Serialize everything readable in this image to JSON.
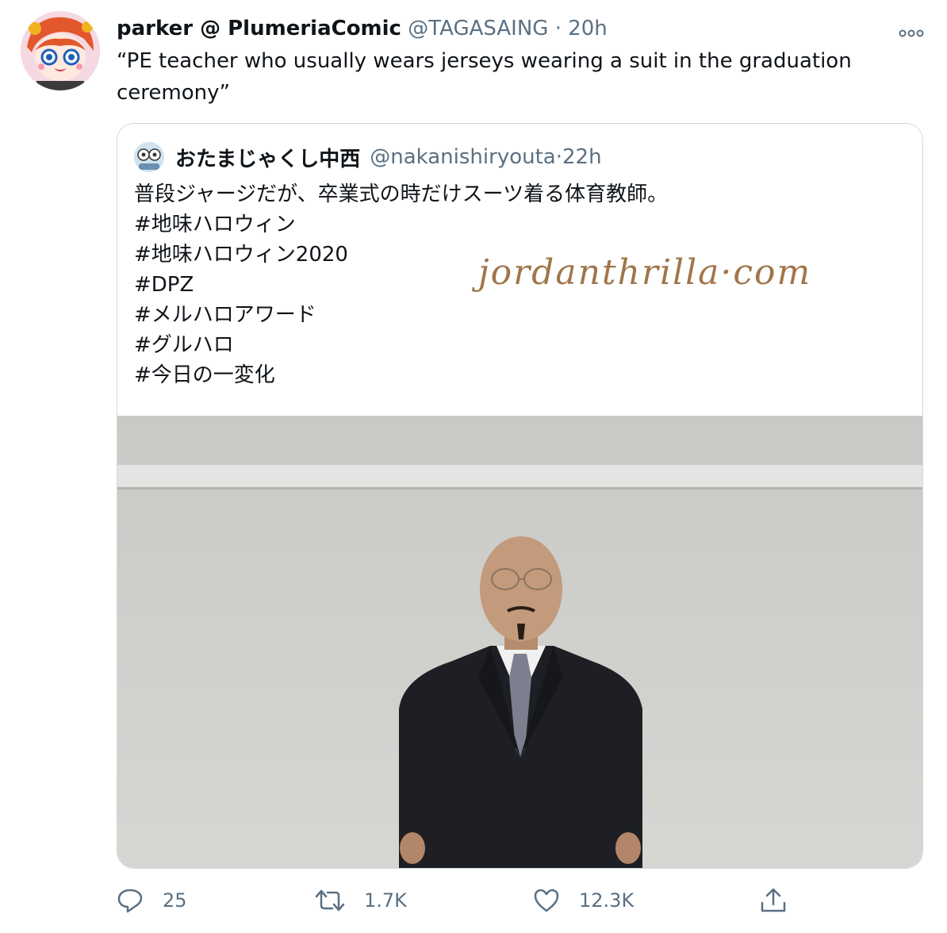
{
  "tweet": {
    "display_name": "parker @ PlumeriaComic",
    "handle": "@TAGASAING",
    "separator": "·",
    "time": "20h",
    "text": "“PE teacher who usually wears jerseys wearing a suit in the graduation ceremony”",
    "more_icon": "more-icon",
    "avatar_icon": "avatar"
  },
  "quote": {
    "display_name": "おたまじゃくし中西",
    "handle": "@nakanishiryouta",
    "separator": "·",
    "time": "22h",
    "lines": [
      "普段ジャージだが、卒業式の時だけスーツ着る体育教師。",
      "#地味ハロウィン",
      "#地味ハロウィン2020",
      "#DPZ",
      "#メルハロアワード",
      "#グルハロ",
      "#今日の一変化"
    ]
  },
  "watermark": "jordanthrilla·com",
  "actions": {
    "reply_count": "25",
    "retweet_count": "1.7K",
    "like_count": "12.3K",
    "icons": [
      "reply-icon",
      "retweet-icon",
      "like-icon",
      "share-icon"
    ]
  },
  "colors": {
    "text": "#0f1419",
    "muted": "#5b7083",
    "border": "#cfd9de",
    "watermark": "#a0764a"
  }
}
